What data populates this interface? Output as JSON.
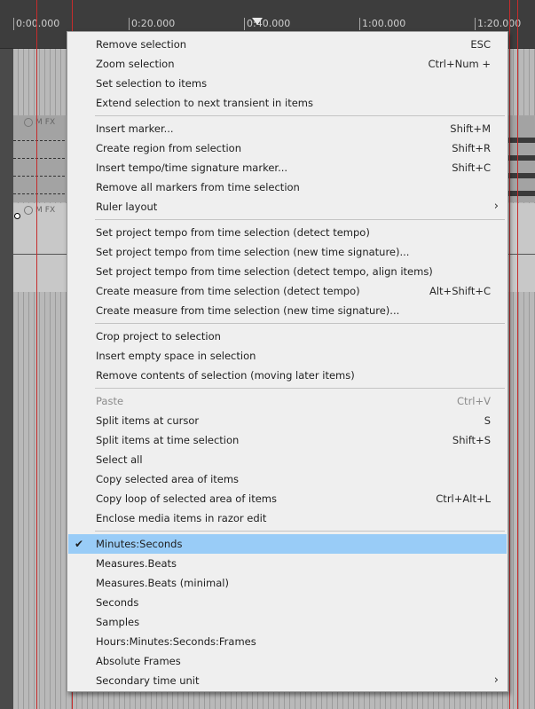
{
  "ruler": {
    "ticks": [
      "0:00.000",
      "0:20.000",
      "0:40.000",
      "1:00.000",
      "1:20.000"
    ]
  },
  "tracks": [
    {
      "buttons": [
        "M",
        "FX"
      ]
    },
    {
      "buttons": [
        "M",
        "FX"
      ]
    }
  ],
  "menu": {
    "groups": [
      [
        {
          "label": "Remove selection",
          "shortcut": "ESC"
        },
        {
          "label": "Zoom selection",
          "shortcut": "Ctrl+Num +"
        },
        {
          "label": "Set selection to items",
          "shortcut": ""
        },
        {
          "label": "Extend selection to next transient in items",
          "shortcut": ""
        }
      ],
      [
        {
          "label": "Insert marker...",
          "shortcut": "Shift+M"
        },
        {
          "label": "Create region from selection",
          "shortcut": "Shift+R"
        },
        {
          "label": "Insert tempo/time signature marker...",
          "shortcut": "Shift+C"
        },
        {
          "label": "Remove all markers from time selection",
          "shortcut": ""
        },
        {
          "label": "Ruler layout",
          "shortcut": "",
          "submenu": true
        }
      ],
      [
        {
          "label": "Set project tempo from time selection (detect tempo)",
          "shortcut": ""
        },
        {
          "label": "Set project tempo from time selection (new time signature)...",
          "shortcut": ""
        },
        {
          "label": "Set project tempo from time selection (detect tempo, align items)",
          "shortcut": ""
        },
        {
          "label": "Create measure from time selection (detect tempo)",
          "shortcut": "Alt+Shift+C"
        },
        {
          "label": "Create measure from time selection (new time signature)...",
          "shortcut": ""
        }
      ],
      [
        {
          "label": "Crop project to selection",
          "shortcut": ""
        },
        {
          "label": "Insert empty space in selection",
          "shortcut": ""
        },
        {
          "label": "Remove contents of selection (moving later items)",
          "shortcut": ""
        }
      ],
      [
        {
          "label": "Paste",
          "shortcut": "Ctrl+V",
          "disabled": true
        },
        {
          "label": "Split items at cursor",
          "shortcut": "S"
        },
        {
          "label": "Split items at time selection",
          "shortcut": "Shift+S"
        },
        {
          "label": "Select all",
          "shortcut": ""
        },
        {
          "label": "Copy selected area of items",
          "shortcut": ""
        },
        {
          "label": "Copy loop of selected area of items",
          "shortcut": "Ctrl+Alt+L"
        },
        {
          "label": "Enclose media items in razor edit",
          "shortcut": ""
        }
      ],
      [
        {
          "label": "Minutes:Seconds",
          "shortcut": "",
          "checked": true,
          "highlighted": true
        },
        {
          "label": "Measures.Beats",
          "shortcut": ""
        },
        {
          "label": "Measures.Beats (minimal)",
          "shortcut": ""
        },
        {
          "label": "Seconds",
          "shortcut": ""
        },
        {
          "label": "Samples",
          "shortcut": ""
        },
        {
          "label": "Hours:Minutes:Seconds:Frames",
          "shortcut": ""
        },
        {
          "label": "Absolute Frames",
          "shortcut": ""
        },
        {
          "label": "Secondary time unit",
          "shortcut": "",
          "submenu": true
        }
      ]
    ],
    "check_glyph": "✔",
    "submenu_glyph": "›"
  },
  "colors": {
    "menu_background": "#efefef",
    "highlight": "#99ccf7",
    "marker_line": "#c62c2c"
  }
}
